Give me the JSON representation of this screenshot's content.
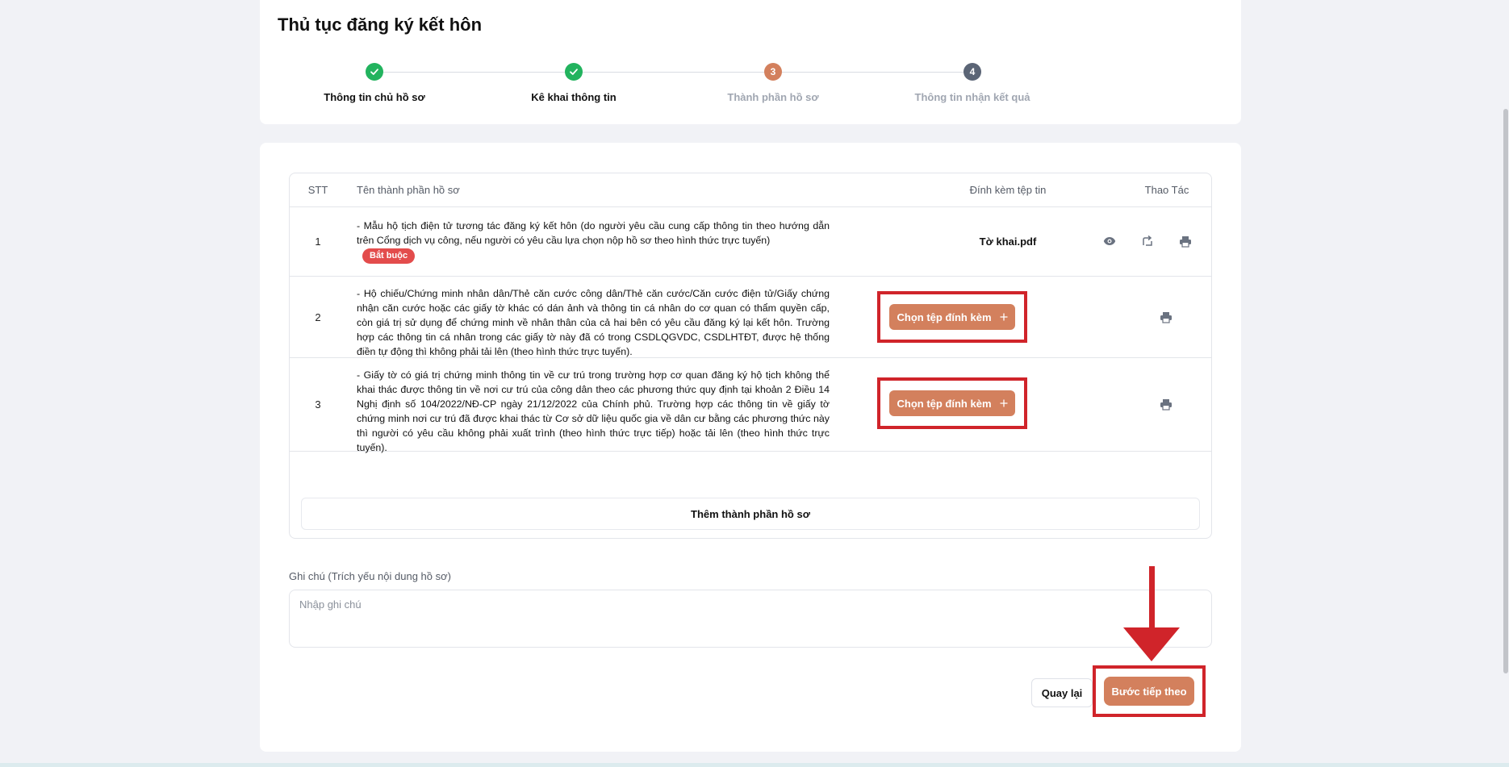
{
  "page": {
    "title": "Thủ tục đăng ký kết hôn"
  },
  "stepper": {
    "steps": [
      {
        "number": "1",
        "label": "Thông tin chủ hồ sơ",
        "status": "done"
      },
      {
        "number": "2",
        "label": "Kê khai thông tin",
        "status": "done"
      },
      {
        "number": "3",
        "label": "Thành phần hồ sơ",
        "status": "active"
      },
      {
        "number": "4",
        "label": "Thông tin nhận kết quả",
        "status": "todo"
      }
    ]
  },
  "table": {
    "headers": {
      "stt": "STT",
      "name": "Tên thành phần hồ sơ",
      "attachment": "Đính kèm tệp tin",
      "actions": "Thao Tác"
    },
    "rows": [
      {
        "stt": "1",
        "name": "- Mẫu hộ tịch điện tử tương tác đăng ký kết hôn (do người yêu cầu cung cấp thông tin theo hướng dẫn trên Cổng dịch vụ công, nếu người có yêu cầu lựa chọn nộp hồ sơ theo hình thức trực tuyến)",
        "badge": "Bắt buộc",
        "file": "Tờ khai.pdf"
      },
      {
        "stt": "2",
        "name": "- Hộ chiếu/Chứng minh nhân dân/Thẻ căn cước công dân/Thẻ căn cước/Căn cước điện tử/Giấy chứng nhận căn cước hoặc các giấy tờ khác có dán ảnh và thông tin cá nhân do cơ quan có thẩm quyền cấp, còn giá trị sử dụng để chứng minh về nhân thân của cả hai bên có yêu cầu đăng ký lại kết hôn. Trường hợp các thông tin cá nhân trong các giấy tờ này đã có trong CSDLQGVDC, CSDLHTĐT, được hệ thống điền tự động thì không phải tải lên (theo hình thức trực tuyến).",
        "attach_label": "Chọn tệp đính kèm"
      },
      {
        "stt": "3",
        "name": "- Giấy tờ có giá trị chứng minh thông tin về cư trú trong trường hợp cơ quan đăng ký hộ tịch không thể khai thác được thông tin về nơi cư trú của công dân theo các phương thức quy định tại khoản 2 Điều 14 Nghị định số 104/2022/NĐ-CP ngày 21/12/2022 của Chính phủ. Trường hợp các thông tin về giấy tờ chứng minh nơi cư trú đã được khai thác từ Cơ sở dữ liệu quốc gia về dân cư bằng các phương thức này thì người có yêu cầu không phải xuất trình (theo hình thức trực tiếp) hoặc tải lên (theo hình thức trực tuyến).",
        "attach_label": "Chọn tệp đính kèm"
      }
    ],
    "add_label": "Thêm thành phần hồ sơ"
  },
  "note": {
    "label": "Ghi chú (Trích yếu nội dung hồ sơ)",
    "placeholder": "Nhập ghi chú",
    "value": ""
  },
  "footer": {
    "back_label": "Quay lại",
    "next_label": "Bước tiếp theo"
  },
  "colors": {
    "accent": "#d3805d",
    "success": "#22b35e",
    "required": "#e34c4c",
    "annotation": "#d0242a"
  },
  "icons": {
    "row1_actions": [
      "eye-icon",
      "share-icon",
      "printer-icon"
    ],
    "row2_actions": [
      "printer-icon"
    ],
    "row3_actions": [
      "printer-icon"
    ],
    "attach": "plus-icon",
    "step_done": "check-icon"
  }
}
